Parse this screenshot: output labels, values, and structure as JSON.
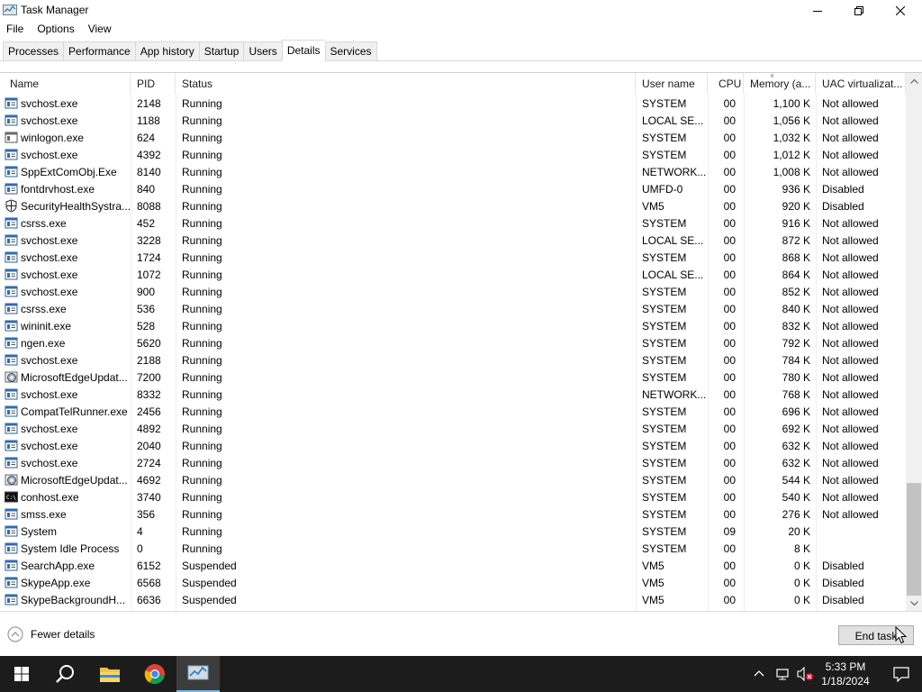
{
  "window": {
    "title": "Task Manager"
  },
  "menu": [
    "File",
    "Options",
    "View"
  ],
  "tabs": [
    {
      "label": "Processes",
      "active": false
    },
    {
      "label": "Performance",
      "active": false
    },
    {
      "label": "App history",
      "active": false
    },
    {
      "label": "Startup",
      "active": false
    },
    {
      "label": "Users",
      "active": false
    },
    {
      "label": "Details",
      "active": true
    },
    {
      "label": "Services",
      "active": false
    }
  ],
  "columns": {
    "name": "Name",
    "pid": "PID",
    "status": "Status",
    "user": "User name",
    "cpu": "CPU",
    "memory": "Memory (a...",
    "uac": "UAC virtualizat..."
  },
  "rows": [
    {
      "icon": "service-icon",
      "name": "svchost.exe",
      "pid": "2148",
      "status": "Running",
      "user": "SYSTEM",
      "cpu": "00",
      "memory": "1,100 K",
      "uac": "Not allowed"
    },
    {
      "icon": "service-icon",
      "name": "svchost.exe",
      "pid": "1188",
      "status": "Running",
      "user": "LOCAL SE...",
      "cpu": "00",
      "memory": "1,056 K",
      "uac": "Not allowed"
    },
    {
      "icon": "window-icon",
      "name": "winlogon.exe",
      "pid": "624",
      "status": "Running",
      "user": "SYSTEM",
      "cpu": "00",
      "memory": "1,032 K",
      "uac": "Not allowed"
    },
    {
      "icon": "service-icon",
      "name": "svchost.exe",
      "pid": "4392",
      "status": "Running",
      "user": "SYSTEM",
      "cpu": "00",
      "memory": "1,012 K",
      "uac": "Not allowed"
    },
    {
      "icon": "service-icon",
      "name": "SppExtComObj.Exe",
      "pid": "8140",
      "status": "Running",
      "user": "NETWORK...",
      "cpu": "00",
      "memory": "1,008 K",
      "uac": "Not allowed"
    },
    {
      "icon": "service-icon",
      "name": "fontdrvhost.exe",
      "pid": "840",
      "status": "Running",
      "user": "UMFD-0",
      "cpu": "00",
      "memory": "936 K",
      "uac": "Disabled"
    },
    {
      "icon": "shield-icon",
      "name": "SecurityHealthSystra...",
      "pid": "8088",
      "status": "Running",
      "user": "VM5",
      "cpu": "00",
      "memory": "920 K",
      "uac": "Disabled"
    },
    {
      "icon": "service-icon",
      "name": "csrss.exe",
      "pid": "452",
      "status": "Running",
      "user": "SYSTEM",
      "cpu": "00",
      "memory": "916 K",
      "uac": "Not allowed"
    },
    {
      "icon": "service-icon",
      "name": "svchost.exe",
      "pid": "3228",
      "status": "Running",
      "user": "LOCAL SE...",
      "cpu": "00",
      "memory": "872 K",
      "uac": "Not allowed"
    },
    {
      "icon": "service-icon",
      "name": "svchost.exe",
      "pid": "1724",
      "status": "Running",
      "user": "SYSTEM",
      "cpu": "00",
      "memory": "868 K",
      "uac": "Not allowed"
    },
    {
      "icon": "service-icon",
      "name": "svchost.exe",
      "pid": "1072",
      "status": "Running",
      "user": "LOCAL SE...",
      "cpu": "00",
      "memory": "864 K",
      "uac": "Not allowed"
    },
    {
      "icon": "service-icon",
      "name": "svchost.exe",
      "pid": "900",
      "status": "Running",
      "user": "SYSTEM",
      "cpu": "00",
      "memory": "852 K",
      "uac": "Not allowed"
    },
    {
      "icon": "service-icon",
      "name": "csrss.exe",
      "pid": "536",
      "status": "Running",
      "user": "SYSTEM",
      "cpu": "00",
      "memory": "840 K",
      "uac": "Not allowed"
    },
    {
      "icon": "service-icon",
      "name": "wininit.exe",
      "pid": "528",
      "status": "Running",
      "user": "SYSTEM",
      "cpu": "00",
      "memory": "832 K",
      "uac": "Not allowed"
    },
    {
      "icon": "service-icon",
      "name": "ngen.exe",
      "pid": "5620",
      "status": "Running",
      "user": "SYSTEM",
      "cpu": "00",
      "memory": "792 K",
      "uac": "Not allowed"
    },
    {
      "icon": "service-icon",
      "name": "svchost.exe",
      "pid": "2188",
      "status": "Running",
      "user": "SYSTEM",
      "cpu": "00",
      "memory": "784 K",
      "uac": "Not allowed"
    },
    {
      "icon": "edge-update-icon",
      "name": "MicrosoftEdgeUpdat...",
      "pid": "7200",
      "status": "Running",
      "user": "SYSTEM",
      "cpu": "00",
      "memory": "780 K",
      "uac": "Not allowed"
    },
    {
      "icon": "service-icon",
      "name": "svchost.exe",
      "pid": "8332",
      "status": "Running",
      "user": "NETWORK...",
      "cpu": "00",
      "memory": "768 K",
      "uac": "Not allowed"
    },
    {
      "icon": "service-icon",
      "name": "CompatTelRunner.exe",
      "pid": "2456",
      "status": "Running",
      "user": "SYSTEM",
      "cpu": "00",
      "memory": "696 K",
      "uac": "Not allowed"
    },
    {
      "icon": "service-icon",
      "name": "svchost.exe",
      "pid": "4892",
      "status": "Running",
      "user": "SYSTEM",
      "cpu": "00",
      "memory": "692 K",
      "uac": "Not allowed"
    },
    {
      "icon": "service-icon",
      "name": "svchost.exe",
      "pid": "2040",
      "status": "Running",
      "user": "SYSTEM",
      "cpu": "00",
      "memory": "632 K",
      "uac": "Not allowed"
    },
    {
      "icon": "service-icon",
      "name": "svchost.exe",
      "pid": "2724",
      "status": "Running",
      "user": "SYSTEM",
      "cpu": "00",
      "memory": "632 K",
      "uac": "Not allowed"
    },
    {
      "icon": "edge-update-icon",
      "name": "MicrosoftEdgeUpdat...",
      "pid": "4692",
      "status": "Running",
      "user": "SYSTEM",
      "cpu": "00",
      "memory": "544 K",
      "uac": "Not allowed"
    },
    {
      "icon": "console-icon",
      "name": "conhost.exe",
      "pid": "3740",
      "status": "Running",
      "user": "SYSTEM",
      "cpu": "00",
      "memory": "540 K",
      "uac": "Not allowed"
    },
    {
      "icon": "service-icon",
      "name": "smss.exe",
      "pid": "356",
      "status": "Running",
      "user": "SYSTEM",
      "cpu": "00",
      "memory": "276 K",
      "uac": "Not allowed"
    },
    {
      "icon": "service-icon",
      "name": "System",
      "pid": "4",
      "status": "Running",
      "user": "SYSTEM",
      "cpu": "09",
      "memory": "20 K",
      "uac": ""
    },
    {
      "icon": "service-icon",
      "name": "System Idle Process",
      "pid": "0",
      "status": "Running",
      "user": "SYSTEM",
      "cpu": "00",
      "memory": "8 K",
      "uac": ""
    },
    {
      "icon": "service-icon",
      "name": "SearchApp.exe",
      "pid": "6152",
      "status": "Suspended",
      "user": "VM5",
      "cpu": "00",
      "memory": "0 K",
      "uac": "Disabled"
    },
    {
      "icon": "service-icon",
      "name": "SkypeApp.exe",
      "pid": "6568",
      "status": "Suspended",
      "user": "VM5",
      "cpu": "00",
      "memory": "0 K",
      "uac": "Disabled"
    },
    {
      "icon": "service-icon",
      "name": "SkypeBackgroundH...",
      "pid": "6636",
      "status": "Suspended",
      "user": "VM5",
      "cpu": "00",
      "memory": "0 K",
      "uac": "Disabled"
    }
  ],
  "footer": {
    "fewer_details": "Fewer details",
    "end_task": "End task"
  },
  "taskbar": {
    "time": "5:33 PM",
    "date": "1/18/2024"
  },
  "colors": {
    "taskbar": "#1c1c1c",
    "accent": "#76b9ed"
  }
}
